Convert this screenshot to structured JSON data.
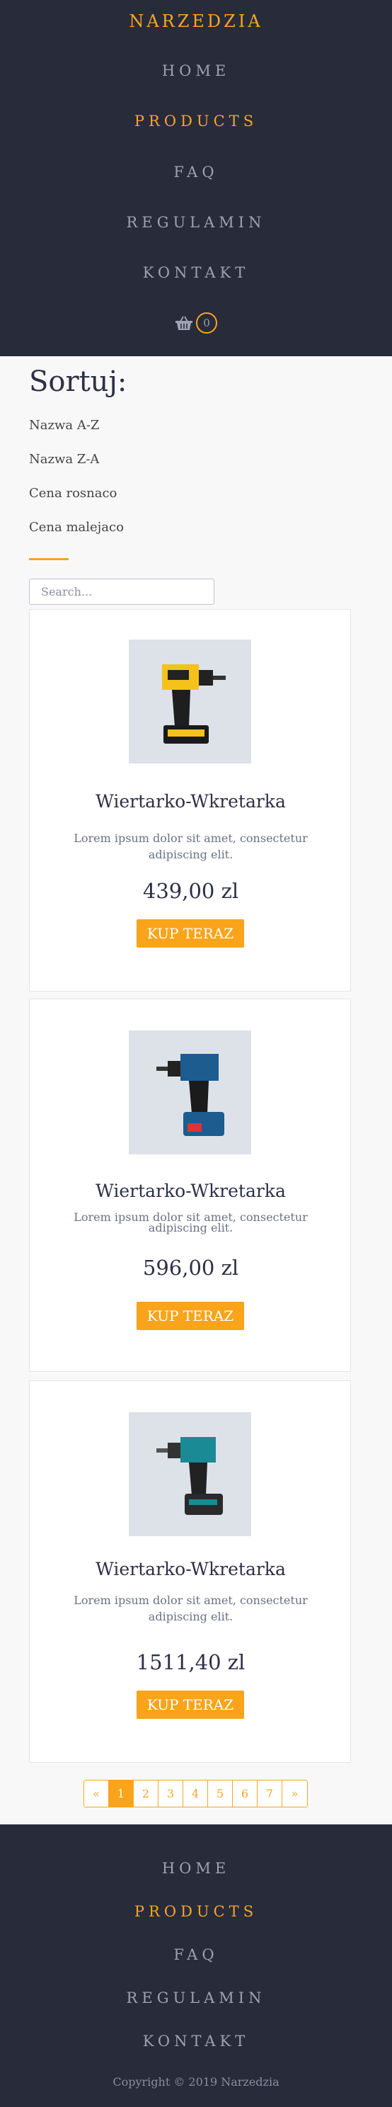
{
  "header": {
    "brand": "NARZEDZIA",
    "nav": [
      {
        "label": "HOME"
      },
      {
        "label": "PRODUCTS",
        "active": true
      },
      {
        "label": "FAQ"
      },
      {
        "label": "REGULAMIN"
      },
      {
        "label": "KONTAKT"
      }
    ],
    "cart": {
      "icon": "basket-icon",
      "count": "0"
    }
  },
  "sort": {
    "title": "Sortuj:",
    "options": [
      "Nazwa A-Z",
      "Nazwa Z-A",
      "Cena rosnaco",
      "Cena malejaco"
    ]
  },
  "search": {
    "placeholder": "Search..."
  },
  "products": [
    {
      "name": "Wiertarko-Wkretarka",
      "desc": "Lorem ipsum dolor sit amet, consectetur adipiscing elit.",
      "price": "439,00 zl",
      "buy": "KUP TERAZ",
      "image": "yellow-drill"
    },
    {
      "name": "Wiertarko-Wkretarka",
      "desc": "Lorem ipsum dolor sit amet, consectetur adipiscing elit.",
      "price": "596,00 zl",
      "buy": "KUP TERAZ",
      "image": "blue-drill"
    },
    {
      "name": "Wiertarko-Wkretarka",
      "desc": "Lorem ipsum dolor sit amet, consectetur adipiscing elit.",
      "price": "1511,40 zl",
      "buy": "KUP TERAZ",
      "image": "teal-drill"
    }
  ],
  "pagination": {
    "prev": "«",
    "pages": [
      "1",
      "2",
      "3",
      "4",
      "5",
      "6",
      "7"
    ],
    "current": "1",
    "next": "»"
  },
  "footer": {
    "nav": [
      "HOME",
      "PRODUCTS",
      "FAQ",
      "REGULAMIN",
      "KONTAKT"
    ],
    "active": "PRODUCTS",
    "copyright": "Copyright © 2019 Narzedzia"
  },
  "colors": {
    "accent": "#f5a623",
    "dark": "#282b3a",
    "button": "#f9a41a"
  }
}
